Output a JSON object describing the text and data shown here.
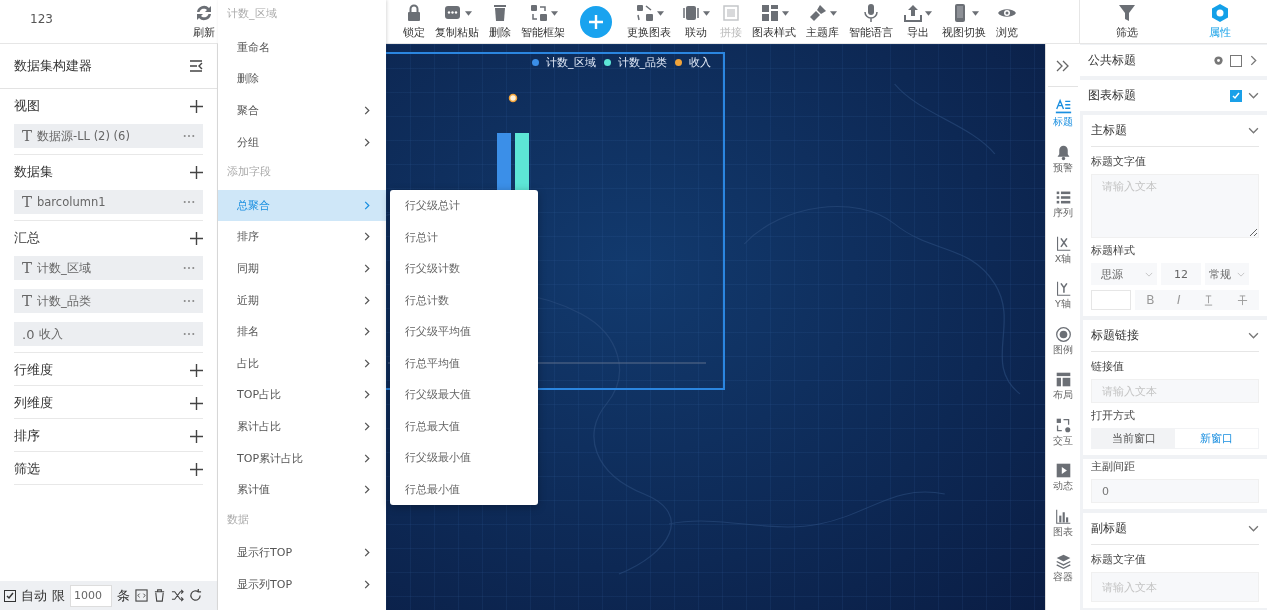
{
  "toolbar": {
    "left_label": "123",
    "refresh": {
      "label": "刷新"
    },
    "items": [
      {
        "kind": "tool",
        "label": "锁定",
        "has_menu": false,
        "disabled": false
      },
      {
        "kind": "tool",
        "label": "复制粘贴",
        "has_menu": true,
        "disabled": false
      },
      {
        "kind": "tool",
        "label": "删除",
        "has_menu": false,
        "disabled": false
      },
      {
        "kind": "tool",
        "label": "智能框架",
        "has_menu": true,
        "disabled": false
      },
      {
        "kind": "add"
      },
      {
        "kind": "tool",
        "label": "更换图表",
        "has_menu": true,
        "disabled": false
      },
      {
        "kind": "tool",
        "label": "联动",
        "has_menu": true,
        "disabled": false
      },
      {
        "kind": "tool",
        "label": "拼接",
        "has_menu": false,
        "disabled": true
      },
      {
        "kind": "tool",
        "label": "图表样式",
        "has_menu": true,
        "disabled": false
      },
      {
        "kind": "tool",
        "label": "主题库",
        "has_menu": true,
        "disabled": false
      },
      {
        "kind": "tool",
        "label": "智能语言",
        "has_menu": false,
        "disabled": false
      },
      {
        "kind": "tool",
        "label": "导出",
        "has_menu": true,
        "disabled": false
      },
      {
        "kind": "tool",
        "label": "视图切换",
        "has_menu": true,
        "disabled": false
      },
      {
        "kind": "tool",
        "label": "浏览",
        "has_menu": false,
        "disabled": false
      }
    ],
    "right_items": [
      {
        "label": "筛选",
        "selected": false
      },
      {
        "label": "属性",
        "selected": true
      }
    ]
  },
  "builder": {
    "title": "数据集构建器",
    "sections": [
      {
        "title": "视图",
        "fields": [
          {
            "type_glyph": "T",
            "name": "数据源-LL (2) (6)"
          }
        ]
      },
      {
        "title": "数据集",
        "fields": [
          {
            "type_glyph": "T",
            "name": "barcolumn1"
          }
        ]
      },
      {
        "title": "汇总",
        "fields": [
          {
            "type_glyph": "T",
            "name": "计数_区域"
          },
          {
            "type_glyph": "T",
            "name": "计数_品类"
          },
          {
            "type_glyph": ".0",
            "name": "收入"
          }
        ]
      },
      {
        "title": "行维度"
      },
      {
        "title": "列维度"
      },
      {
        "title": "排序"
      },
      {
        "title": "筛选"
      }
    ],
    "footer": {
      "auto_checked": true,
      "auto_label": "自动",
      "limit_label": "限",
      "limit_value": "1000",
      "unit": "条"
    }
  },
  "context_menu": {
    "title": "计数_区域",
    "items": [
      {
        "kind": "item",
        "label": "重命名",
        "has_submenu": false,
        "selected": false
      },
      {
        "kind": "item",
        "label": "删除",
        "has_submenu": false,
        "selected": false
      },
      {
        "kind": "item",
        "label": "聚合",
        "has_submenu": true,
        "selected": false
      },
      {
        "kind": "item",
        "label": "分组",
        "has_submenu": true,
        "selected": false
      },
      {
        "kind": "header",
        "label": "添加字段"
      },
      {
        "kind": "item",
        "label": "总聚合",
        "has_submenu": true,
        "selected": true
      },
      {
        "kind": "item",
        "label": "排序",
        "has_submenu": true,
        "selected": false
      },
      {
        "kind": "item",
        "label": "同期",
        "has_submenu": true,
        "selected": false
      },
      {
        "kind": "item",
        "label": "近期",
        "has_submenu": true,
        "selected": false
      },
      {
        "kind": "item",
        "label": "排名",
        "has_submenu": true,
        "selected": false
      },
      {
        "kind": "item",
        "label": "占比",
        "has_submenu": true,
        "selected": false
      },
      {
        "kind": "item",
        "label": "TOP占比",
        "has_submenu": true,
        "selected": false
      },
      {
        "kind": "item",
        "label": "累计占比",
        "has_submenu": true,
        "selected": false
      },
      {
        "kind": "item",
        "label": "TOP累计占比",
        "has_submenu": true,
        "selected": false
      },
      {
        "kind": "item",
        "label": "累计值",
        "has_submenu": true,
        "selected": false
      },
      {
        "kind": "header",
        "label": "数据"
      },
      {
        "kind": "item",
        "label": "显示行TOP",
        "has_submenu": true,
        "selected": false
      },
      {
        "kind": "item",
        "label": "显示列TOP",
        "has_submenu": true,
        "selected": false
      }
    ]
  },
  "submenu": {
    "items": [
      {
        "label": "行父级总计",
        "selected": false
      },
      {
        "label": "行总计",
        "selected": false
      },
      {
        "label": "行父级计数",
        "selected": false
      },
      {
        "label": "行总计数",
        "selected": false
      },
      {
        "label": "行父级平均值",
        "selected": false
      },
      {
        "label": "行总平均值",
        "selected": false
      },
      {
        "label": "行父级最大值",
        "selected": false
      },
      {
        "label": "行总最大值",
        "selected": false
      },
      {
        "label": "行父级最小值",
        "selected": false
      },
      {
        "label": "行总最小值",
        "selected": false
      }
    ]
  },
  "chart": {
    "legend": [
      {
        "label": "计数_区域",
        "color": "#3b8fe8"
      },
      {
        "label": "计数_品类",
        "color": "#5de6d6"
      },
      {
        "label": "收入",
        "color": "#f2a43a"
      }
    ]
  },
  "side_nav": {
    "items": [
      {
        "label": "标题",
        "selected": true
      },
      {
        "label": "预警",
        "selected": false
      },
      {
        "label": "序列",
        "selected": false
      },
      {
        "label": "X轴",
        "selected": false
      },
      {
        "label": "Y轴",
        "selected": false
      },
      {
        "label": "图例",
        "selected": false
      },
      {
        "label": "布局",
        "selected": false
      },
      {
        "label": "交互",
        "selected": false
      },
      {
        "label": "动态",
        "selected": false
      },
      {
        "label": "图表",
        "selected": false
      },
      {
        "label": "容器",
        "selected": false
      }
    ]
  },
  "properties": {
    "public_title": {
      "label": "公共标题",
      "checked": false,
      "expanded": false
    },
    "chart_title": {
      "label": "图表标题",
      "checked": true,
      "expanded": true
    },
    "main_title": {
      "heading": "主标题",
      "expanded": true,
      "text_label": "标题文字值",
      "text_placeholder": "请输入文本",
      "style_label": "标题样式",
      "font": "思源",
      "size": "12",
      "weight": "常规",
      "format_buttons": [
        {
          "kind": "bold",
          "glyph": "B"
        },
        {
          "kind": "italic",
          "glyph": "I"
        },
        {
          "kind": "underline"
        },
        {
          "kind": "strikethrough"
        }
      ]
    },
    "link": {
      "heading": "标题链接",
      "expanded": true,
      "value_label": "链接值",
      "value_placeholder": "请输入文本",
      "open_label": "打开方式",
      "open_options": [
        {
          "label": "当前窗口",
          "selected": false
        },
        {
          "label": "新窗口",
          "selected": true
        }
      ]
    },
    "gap": {
      "label": "主副间距",
      "value": "0"
    },
    "subtitle": {
      "heading": "副标题",
      "expanded": true,
      "text_label": "标题文字值",
      "text_placeholder": "请输入文本"
    }
  }
}
